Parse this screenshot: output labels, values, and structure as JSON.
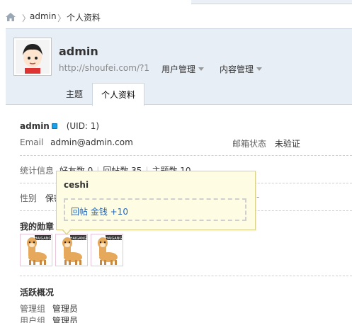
{
  "breadcrumb": {
    "items": [
      "admin",
      "个人资料"
    ]
  },
  "profile": {
    "username": "admin",
    "url": "http://shoufei.com/?1",
    "menus": [
      "用户管理",
      "内容管理"
    ],
    "tabs": [
      {
        "label": "主题",
        "active": false
      },
      {
        "label": "个人资料",
        "active": true
      }
    ]
  },
  "info": {
    "name": "admin",
    "uid": "(UID: 1)",
    "email_label": "Email",
    "email_value": "admin@admin.com",
    "mail_status_label": "邮箱状态",
    "mail_status_value": "未验证",
    "stats_label": "统计信息",
    "stats": [
      "好友数 0",
      "回帖数 35",
      "主题数 10"
    ],
    "gender_label": "性别",
    "gender_value_partial": "保密",
    "medals_heading": "我的勋章",
    "medal_tag": "HAIGANG",
    "medal_count": 3,
    "activity_heading": "活跃概况",
    "group_label": "管理组",
    "group_value": "管理员",
    "usergroup_label": "用户组",
    "usergroup_value": "管理员"
  },
  "tooltip": {
    "title": "ceshi",
    "reward": "回帖 金钱 +10"
  },
  "colors": {
    "link": "#2266bb",
    "header_bg": "#e8eef5",
    "tooltip_bg": "#fefde3",
    "qq_icon": "#19a0e6"
  }
}
